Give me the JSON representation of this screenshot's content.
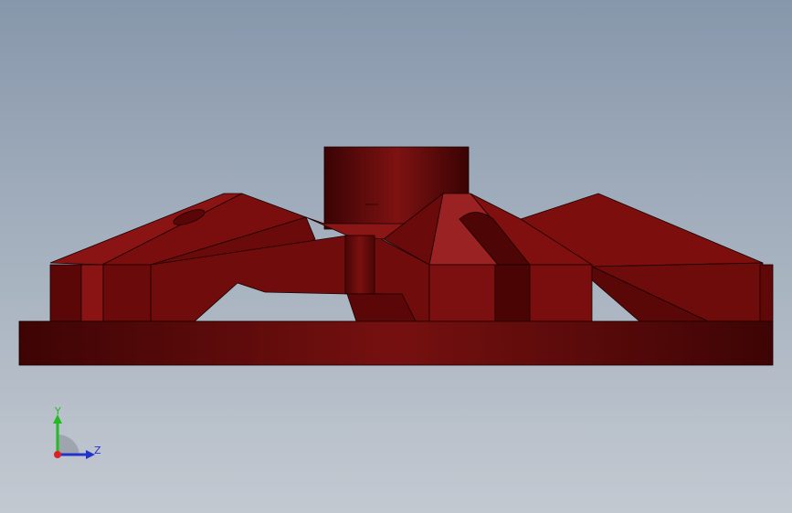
{
  "viewport": {
    "background_top": "#8797ab",
    "background_bottom": "#c3c9d1"
  },
  "model": {
    "color": "#7a0c0c",
    "dark_color": "#4a0606",
    "light_color": "#9a2222"
  },
  "triad": {
    "y_label": "Y",
    "z_label": "Z",
    "y_color": "#22bb22",
    "z_color": "#2233cc",
    "x_color": "#dd2222"
  }
}
